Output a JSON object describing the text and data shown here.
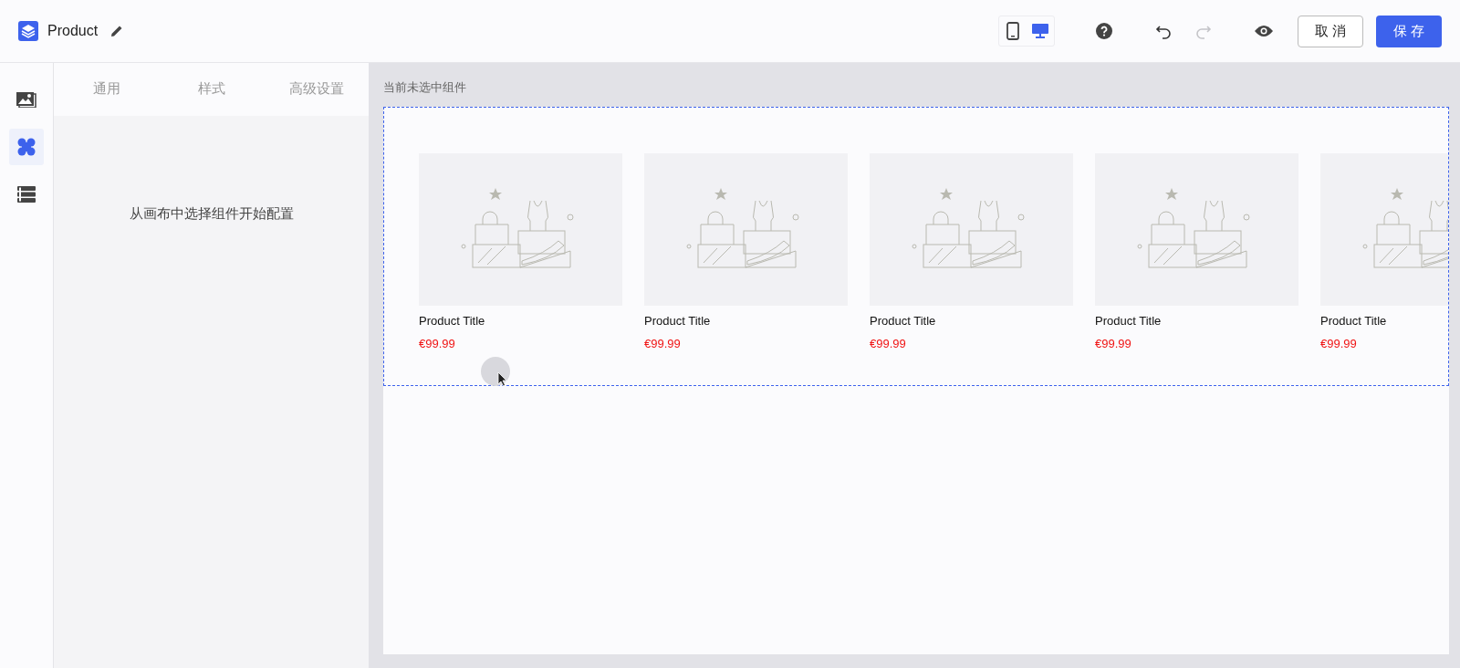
{
  "header": {
    "title": "Product",
    "devices": [
      {
        "kind": "mobile",
        "selected": false
      },
      {
        "kind": "desktop",
        "selected": true
      }
    ],
    "history": [
      {
        "kind": "undo",
        "disabled": false
      },
      {
        "kind": "redo",
        "disabled": true
      }
    ],
    "cancel": "取 消",
    "save": "保 存"
  },
  "rail": [
    {
      "kind": "media",
      "selected": false
    },
    {
      "kind": "components",
      "selected": true
    },
    {
      "kind": "layers",
      "selected": false
    }
  ],
  "panel": {
    "tabs": [
      {
        "label": "通用",
        "selected": false
      },
      {
        "label": "样式",
        "selected": false
      },
      {
        "label": "高级设置",
        "selected": false
      }
    ],
    "empty_message": "从画布中选择组件开始配置"
  },
  "canvas": {
    "status": "当前未选中组件",
    "products": [
      {
        "title": "Product Title",
        "price": "€99.99"
      },
      {
        "title": "Product Title",
        "price": "€99.99"
      },
      {
        "title": "Product Title",
        "price": "€99.99"
      },
      {
        "title": "Product Title",
        "price": "€99.99"
      },
      {
        "title": "Product Title",
        "price": "€99.99"
      }
    ]
  }
}
